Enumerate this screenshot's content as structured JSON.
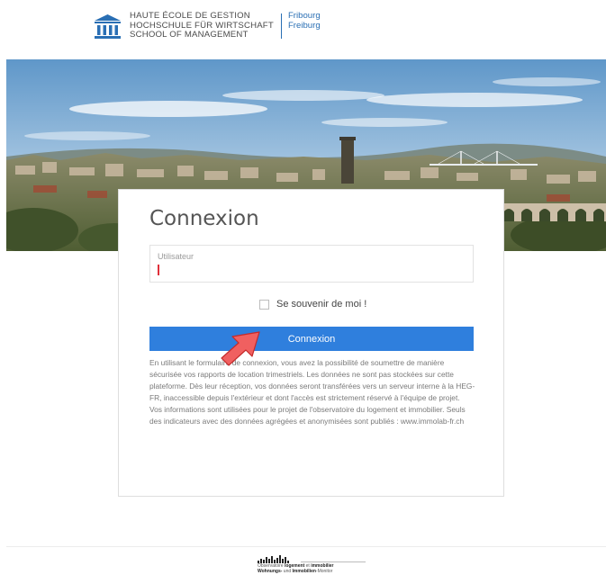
{
  "header": {
    "logo_lines": [
      "HAUTE ÉCOLE DE GESTION",
      "HOCHSCHULE FÜR WIRTSCHAFT",
      "SCHOOL OF MANAGEMENT"
    ],
    "city_lines": [
      "Fribourg",
      "Freiburg"
    ],
    "brand_color": "#2a6fb4"
  },
  "login": {
    "title": "Connexion",
    "username_label": "Utilisateur",
    "username_value": "",
    "remember_label": "Se souvenir de moi !",
    "remember_checked": false,
    "submit_label": "Connexion",
    "submit_color": "#2f7fdd",
    "info_paragraphs": [
      "En utilisant le formulaire de connexion, vous avez la possibilité de soumettre de manière sécurisée vos rapports de location trimestriels. Les données ne sont pas stockées sur cette plateforme. Dès leur réception, vos données seront transférées vers un serveur interne à la HEG-FR, inaccessible depuis l'extérieur et dont l'accès est strictement réservé à l'équipe de projet.",
      "Vos informations sont utilisées pour le projet de l'observatoire du logement et immobilier. Seuls des indicateurs avec des données agrégées et anonymisées sont publiés : www.immolab-fr.ch"
    ]
  },
  "footer": {
    "line1_pre": "Observatoire",
    "line1_b1": "logement",
    "line1_mid": "et",
    "line1_b2": "immobilier",
    "line2_b1": "Wohnungs-",
    "line2_mid": "und",
    "line2_b2": "Immobilien",
    "line2_post": "-Monitor"
  },
  "icons": {
    "logo": "school-building-icon",
    "cursor": "mouse-pointer-icon",
    "footer": "bar-chart-logo-icon"
  }
}
